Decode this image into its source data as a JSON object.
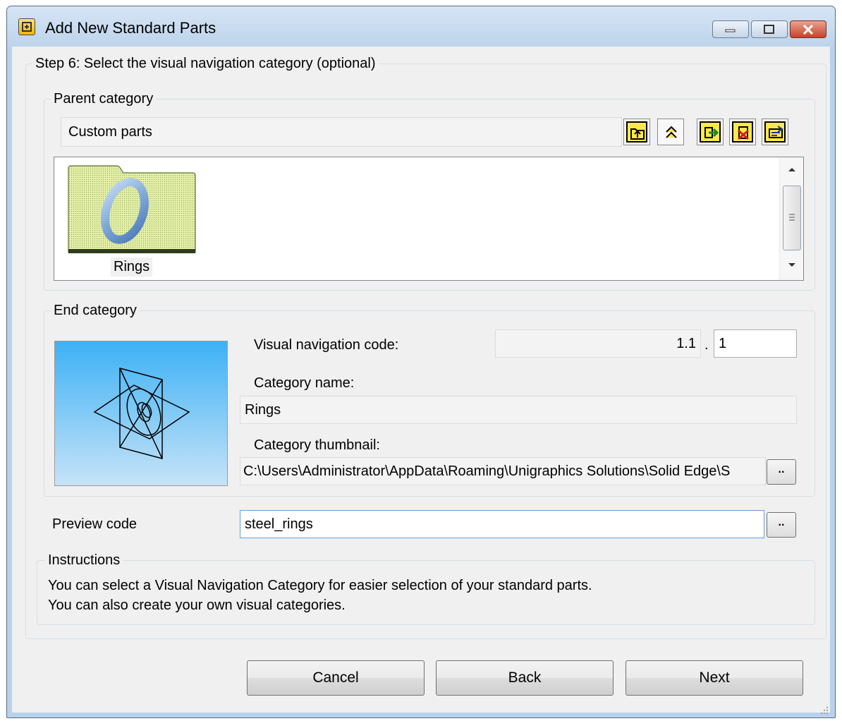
{
  "window": {
    "title": "Add New Standard Parts"
  },
  "step": {
    "title": "Step 6: Select the visual navigation category (optional)"
  },
  "parent_category": {
    "legend": "Parent category",
    "path": "Custom parts",
    "toolbar_icons": [
      "folder-up-icon",
      "collapse-icon",
      "add-category-icon",
      "delete-category-icon",
      "edit-category-icon"
    ],
    "items": [
      {
        "label": "Rings",
        "icon": "ring-folder-icon",
        "selected": true
      }
    ]
  },
  "end_category": {
    "legend": "End category",
    "nav_code_label": "Visual navigation code:",
    "nav_code_prefix": "1.1",
    "nav_code_separator": ".",
    "nav_code_value": "1",
    "name_label": "Category name:",
    "name_value": "Rings",
    "thumbnail_label": "Category thumbnail:",
    "thumbnail_path": "C:\\Users\\Administrator\\AppData\\Roaming\\Unigraphics Solutions\\Solid Edge\\S",
    "browse_label": ".."
  },
  "preview": {
    "label": "Preview code",
    "value": "steel_rings",
    "browse_label": ".."
  },
  "instructions": {
    "legend": "Instructions",
    "line1": "You can select a Visual Navigation Category for easier selection of your standard parts.",
    "line2": "You can also create your own visual categories."
  },
  "buttons": {
    "cancel": "Cancel",
    "back": "Back",
    "next": "Next"
  },
  "colors": {
    "frame": "#b9d1ea",
    "dialog_bg": "#f0f0f0",
    "close_red": "#c7432a",
    "toolbar_yellow": "#ffe94a",
    "folder_green": "#d9e8a0",
    "preview_blue": "#3db1f5"
  }
}
